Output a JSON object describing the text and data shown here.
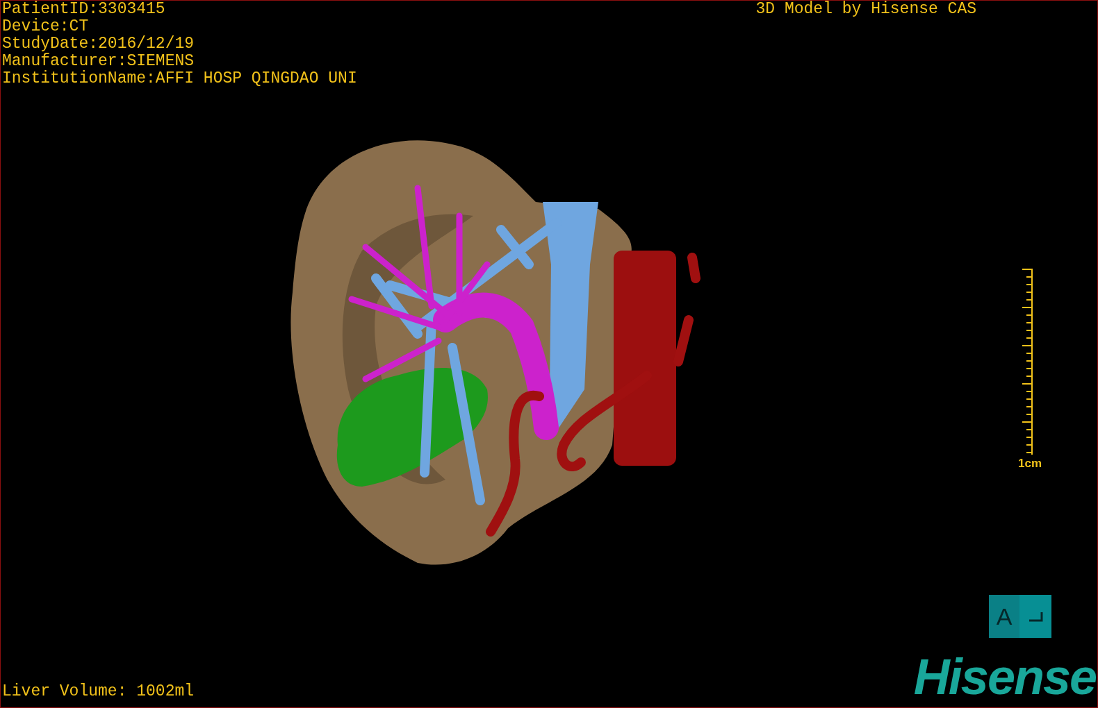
{
  "info": [
    "PatientID:3303415",
    "Device:CT",
    "StudyDate:2016/12/19",
    "Manufacturer:SIEMENS",
    "InstitutionName:AFFI HOSP QINGDAO UNI"
  ],
  "title": "3D Model by Hisense CAS",
  "scale": {
    "label": "1cm"
  },
  "orientation": {
    "face": "A"
  },
  "volume": "Liver Volume: 1002ml",
  "logo": "Hisense"
}
